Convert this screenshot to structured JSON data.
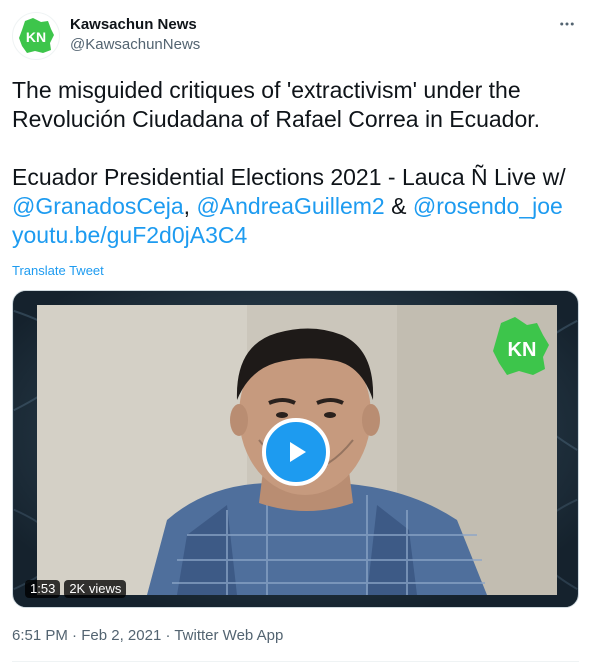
{
  "author": {
    "display_name": "Kawsachun News",
    "handle": "@KawsachunNews",
    "avatar_initials": "KN",
    "avatar_color": "#3dc54b"
  },
  "tweet": {
    "line1": "The misguided critiques of 'extractivism' under the Revolución Ciudadana of Rafael Correa in Ecuador.",
    "line2_prefix": "Ecuador Presidential Elections 2021 - Lauca Ñ Live w/ ",
    "mention1": "@GranadosCeja",
    "sep1": ", ",
    "mention2": "@AndreaGuillem2",
    "sep2": " & ",
    "mention3": "@rosendo_joe",
    "url": "youtu.be/guF2d0jA3C4",
    "translate_label": "Translate Tweet"
  },
  "video": {
    "duration": "1:53",
    "views": "2K views",
    "watermark": "KN"
  },
  "footer": {
    "time": "6:51 PM",
    "dot1": " · ",
    "date": "Feb 2, 2021",
    "dot2": " · ",
    "source": "Twitter Web App"
  },
  "colors": {
    "link": "#1d9bf0",
    "secondary_text": "#536471",
    "brand_green": "#3dc54b"
  },
  "icons": {
    "more": "more-horizontal-icon",
    "play": "play-icon"
  }
}
